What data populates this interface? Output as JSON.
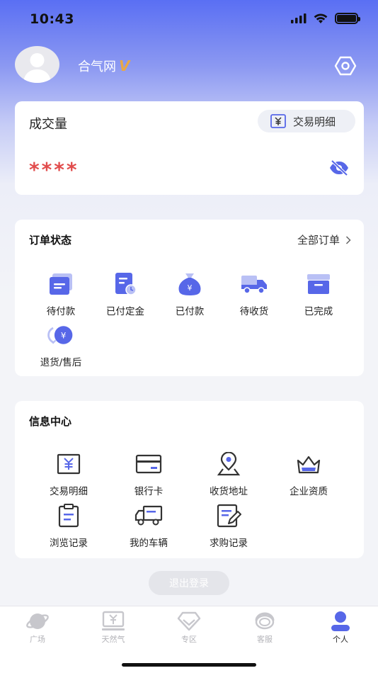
{
  "status_bar": {
    "time": "10:43"
  },
  "header": {
    "username": "合气网",
    "vip_badge": "V"
  },
  "volume_card": {
    "label": "成交量",
    "trade_detail_label": "交易明细",
    "masked_value": "****"
  },
  "order_status": {
    "title": "订单状态",
    "all_orders_label": "全部订单",
    "items": [
      {
        "label": "待付款",
        "icon": "wallet-icon"
      },
      {
        "label": "已付定金",
        "icon": "deposit-doc-icon"
      },
      {
        "label": "已付款",
        "icon": "money-bag-icon"
      },
      {
        "label": "待收货",
        "icon": "truck-icon"
      },
      {
        "label": "已完成",
        "icon": "archive-box-icon"
      },
      {
        "label": "退货/售后",
        "icon": "refund-icon"
      }
    ]
  },
  "info_center": {
    "title": "信息中心",
    "items": [
      {
        "label": "交易明细",
        "icon": "yen-receipt-icon"
      },
      {
        "label": "银行卡",
        "icon": "bank-card-icon"
      },
      {
        "label": "收货地址",
        "icon": "location-pin-icon"
      },
      {
        "label": "企业资质",
        "icon": "crown-icon"
      },
      {
        "label": "浏览记录",
        "icon": "clipboard-icon"
      },
      {
        "label": "我的车辆",
        "icon": "vehicle-icon"
      },
      {
        "label": "求购记录",
        "icon": "edit-doc-icon"
      }
    ]
  },
  "logout_label": "退出登录",
  "tab_bar": {
    "tabs": [
      {
        "label": "广场",
        "icon": "planet-icon"
      },
      {
        "label": "天然气",
        "icon": "monitor-yen-icon"
      },
      {
        "label": "专区",
        "icon": "diamond-icon"
      },
      {
        "label": "客服",
        "icon": "headset-icon"
      },
      {
        "label": "个人",
        "icon": "person-icon"
      }
    ],
    "active_tab": "个人"
  },
  "colors": {
    "accent": "#5767e8",
    "header_gradient_top": "#5a6ff3",
    "masked_value": "#e14c4c",
    "vip_badge": "#e8a847"
  }
}
